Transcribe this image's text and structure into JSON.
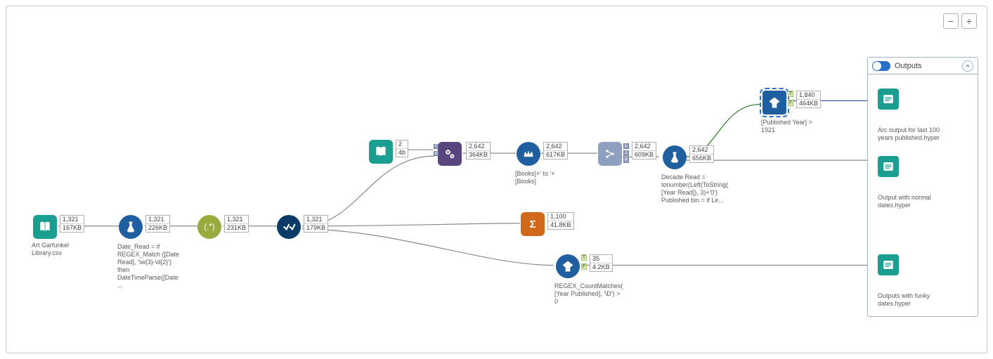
{
  "zoom": {
    "minus": "−",
    "plus": "+"
  },
  "outputs_panel": {
    "title": "Outputs"
  },
  "nodes": {
    "input": {
      "caption": "Art Garfunkel Library.csv",
      "stat1": "1,321",
      "stat2": "167KB"
    },
    "formula1": {
      "caption": "Date_Read = if REGEX_Match ([Date Read], '\\w{3}-\\d{2}') then DateTimeParse([Date ...",
      "stat1": "1,321",
      "stat2": "226KB"
    },
    "regex1": {
      "stat1": "1,321",
      "stat2": "231KB"
    },
    "select1": {
      "stat1": "1,321",
      "stat2": "179KB"
    },
    "textinput": {
      "stat1": "2",
      "stat2": "4b"
    },
    "gears": {
      "stat1": "2,642",
      "stat2": "364KB"
    },
    "crown": {
      "caption": "[Books]+' to '+[Books]",
      "stat1": "2,642",
      "stat2": "617KB"
    },
    "fork": {
      "stat1": "2,642",
      "stat2": "609KB"
    },
    "formula2": {
      "caption": "Decade Read = tonumber(Left(ToString([Year Read]), 3)+'0')  Published bin = if Le...",
      "stat1": "2,642",
      "stat2": "656KB"
    },
    "filter_pub": {
      "caption": "[Published Year] > 1921",
      "stat1": "1,840",
      "stat2": "464KB"
    },
    "sigma": {
      "stat1": "1,100",
      "stat2": "41.8KB"
    },
    "filter_regex": {
      "caption": "REGEX_CountMatches([Year Published], '\\D') > 0",
      "stat1": "35",
      "stat2": "4.2KB"
    },
    "out1": {
      "caption": "Arc output for last 100 years published.hyper"
    },
    "out2": {
      "caption": "Output with normal dates.hyper"
    },
    "out3": {
      "caption": "Outputs with funky dates.hyper"
    }
  }
}
